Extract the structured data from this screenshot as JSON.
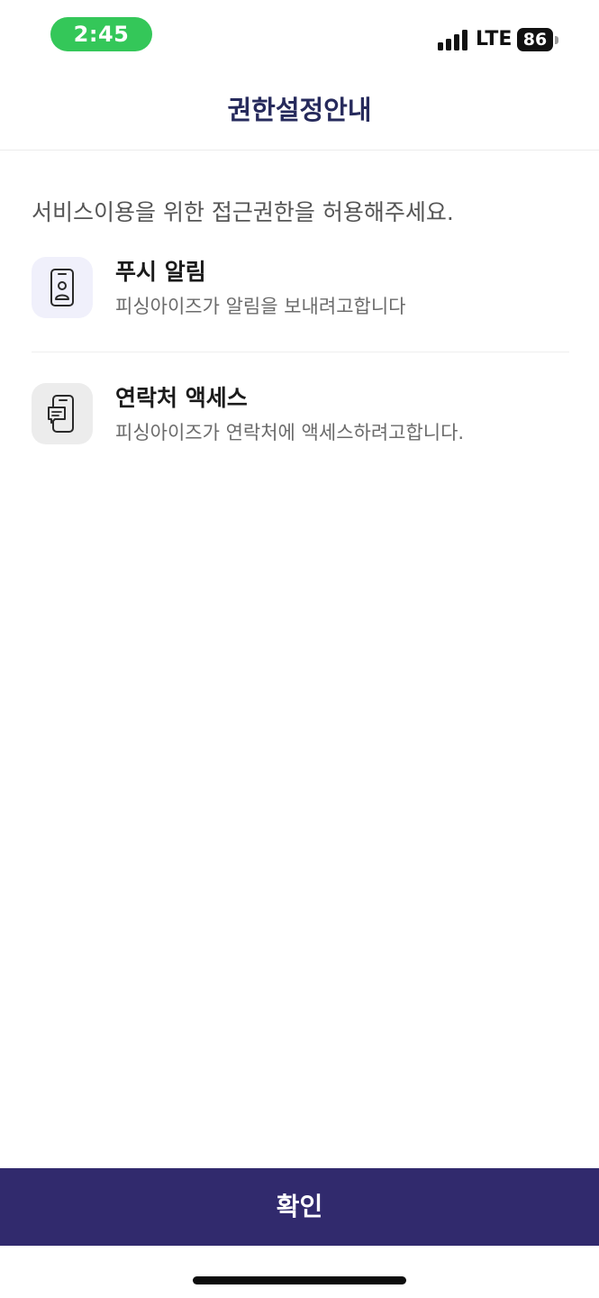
{
  "status_bar": {
    "time": "2:45",
    "network": "LTE",
    "battery_level": "86",
    "time_pill_color": "#34c759",
    "icons": [
      "signal-icon",
      "battery-icon"
    ]
  },
  "header": {
    "title": "권한설정안내"
  },
  "intro": {
    "text": "서비스이용을 위한 접근권한을 허용해주세요."
  },
  "permissions": [
    {
      "icon": "phone-person-icon",
      "title": "푸시 알림",
      "description": "피싱아이즈가 알림을 보내려고합니다"
    },
    {
      "icon": "phone-chat-icon",
      "title": "연락처 액세스",
      "description": "피싱아이즈가 연락처에 액세스하려고합니다."
    }
  ],
  "confirm_button": {
    "label": "확인",
    "color": "#312a6d"
  },
  "colors": {
    "title": "#262a5c",
    "icon_bg_first": "#f0f0fb",
    "icon_bg_second": "#ececec"
  }
}
